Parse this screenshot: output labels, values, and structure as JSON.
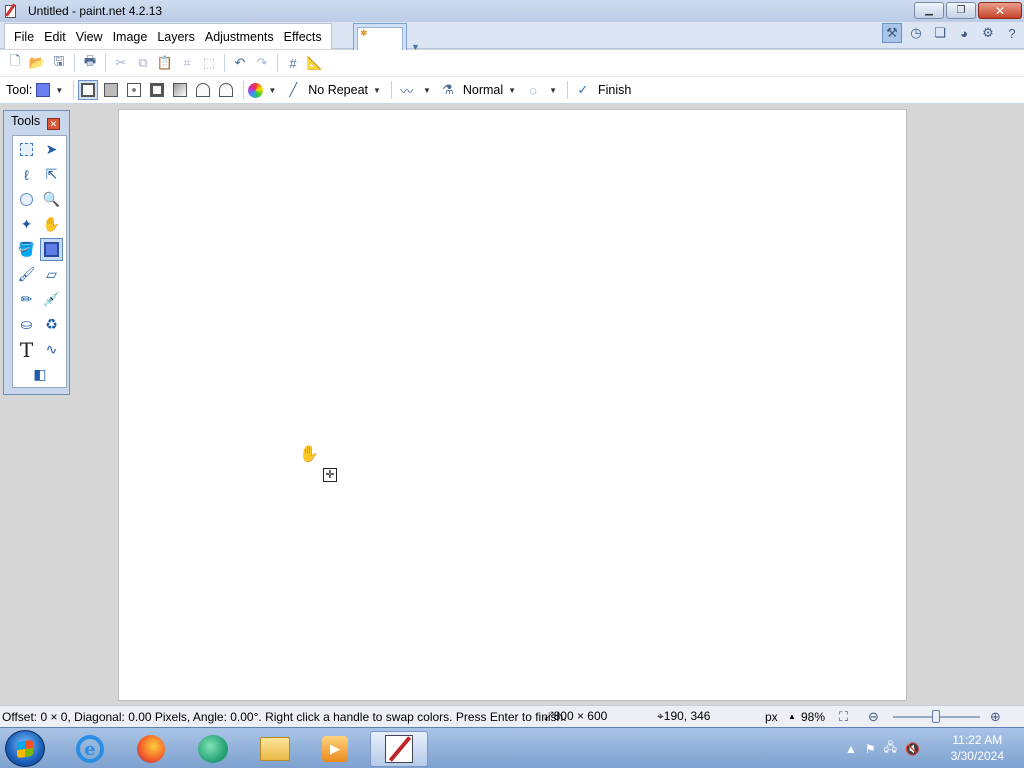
{
  "window": {
    "title": "Untitled - paint.net 4.2.13"
  },
  "menu": [
    "File",
    "Edit",
    "View",
    "Image",
    "Layers",
    "Adjustments",
    "Effects"
  ],
  "toolbar": {
    "tool_label": "Tool:",
    "repeat_mode": "No Repeat",
    "blend_mode": "Normal",
    "finish_label": "Finish",
    "primary_color": "#6c7ff0"
  },
  "tools_window": {
    "title": "Tools"
  },
  "statusbar": {
    "message": "Offset: 0 × 0, Diagonal: 0.00 Pixels, Angle: 0.00°. Right click a handle to swap colors. Press Enter to finish.",
    "image_size": "800 × 600",
    "cursor_position": "190, 346",
    "units": "px",
    "zoom": "98%"
  },
  "taskbar": {
    "time": "11:22 AM",
    "date": "3/30/2024"
  },
  "colors": {
    "accent": "#c4dbf6",
    "canvas": "#ffffff",
    "workspace": "#d6d6d6"
  }
}
